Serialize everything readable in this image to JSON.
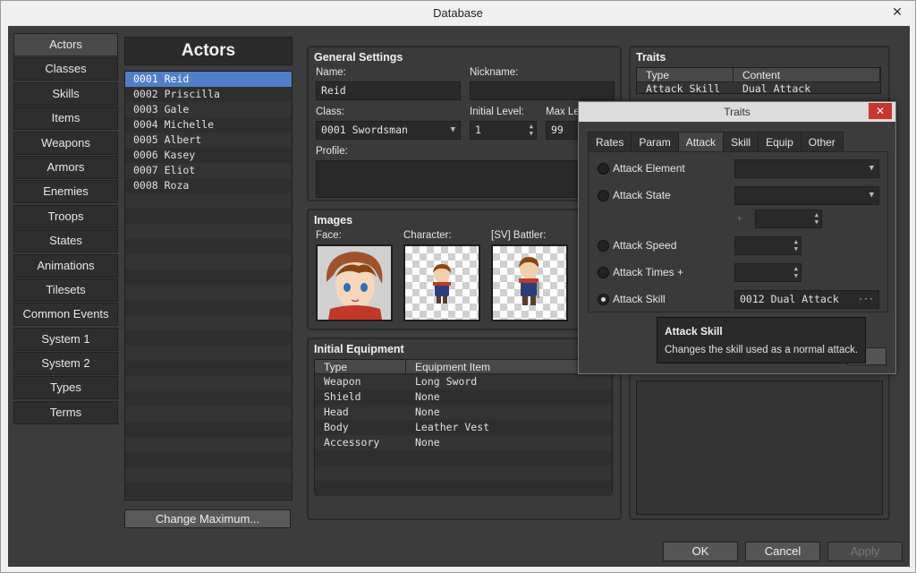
{
  "window": {
    "title": "Database",
    "close_glyph": "✕"
  },
  "categories": [
    {
      "label": "Actors",
      "active": true
    },
    {
      "label": "Classes"
    },
    {
      "label": "Skills"
    },
    {
      "label": "Items"
    },
    {
      "label": "Weapons"
    },
    {
      "label": "Armors"
    },
    {
      "label": "Enemies"
    },
    {
      "label": "Troops"
    },
    {
      "label": "States"
    },
    {
      "label": "Animations"
    },
    {
      "label": "Tilesets"
    },
    {
      "label": "Common Events"
    },
    {
      "label": "System 1"
    },
    {
      "label": "System 2"
    },
    {
      "label": "Types"
    },
    {
      "label": "Terms"
    }
  ],
  "actors": {
    "title": "Actors",
    "items": [
      "0001 Reid",
      "0002 Priscilla",
      "0003 Gale",
      "0004 Michelle",
      "0005 Albert",
      "0006 Kasey",
      "0007 Eliot",
      "0008 Roza"
    ],
    "change_max_label": "Change Maximum..."
  },
  "general": {
    "title": "General Settings",
    "name_label": "Name:",
    "name_value": "Reid",
    "nickname_label": "Nickname:",
    "nickname_value": "",
    "class_label": "Class:",
    "class_value": "0001 Swordsman",
    "initial_level_label": "Initial Level:",
    "initial_level_value": "1",
    "max_level_label": "Max Le",
    "max_level_value": "99",
    "profile_label": "Profile:"
  },
  "images": {
    "title": "Images",
    "face_label": "Face:",
    "character_label": "Character:",
    "battler_label": "[SV] Battler:"
  },
  "equipment": {
    "title": "Initial Equipment",
    "columns": [
      "Type",
      "Equipment Item"
    ],
    "rows": [
      [
        "Weapon",
        "Long Sword"
      ],
      [
        "Shield",
        "None"
      ],
      [
        "Head",
        "None"
      ],
      [
        "Body",
        "Leather Vest"
      ],
      [
        "Accessory",
        "None"
      ]
    ]
  },
  "traits": {
    "title": "Traits",
    "columns": [
      "Type",
      "Content"
    ],
    "rows": [
      [
        "Attack Skill",
        "Dual Attack"
      ]
    ]
  },
  "traits_dialog": {
    "title": "Traits",
    "close_glyph": "✕",
    "tabs": [
      "Rates",
      "Param",
      "Attack",
      "Skill",
      "Equip",
      "Other"
    ],
    "active_tab": "Attack",
    "options": [
      {
        "label": "Attack Element",
        "value": ""
      },
      {
        "label": "Attack State",
        "value": ""
      },
      {
        "label": "Attack Speed",
        "value": ""
      },
      {
        "label": "Attack Times +",
        "value": ""
      },
      {
        "label": "Attack Skill",
        "value": "0012 Dual Attack",
        "selected": true
      }
    ],
    "plus_glyph": "+",
    "ellipsis": "···"
  },
  "tooltip": {
    "title": "Attack Skill",
    "body": "Changes the skill used as a normal attack."
  },
  "buttons": {
    "ok": "OK",
    "cancel": "Cancel",
    "apply": "Apply"
  },
  "colors": {
    "selection": "#4f7fc9",
    "close_red": "#c8362d",
    "panel_bg": "#3a3a3a"
  }
}
